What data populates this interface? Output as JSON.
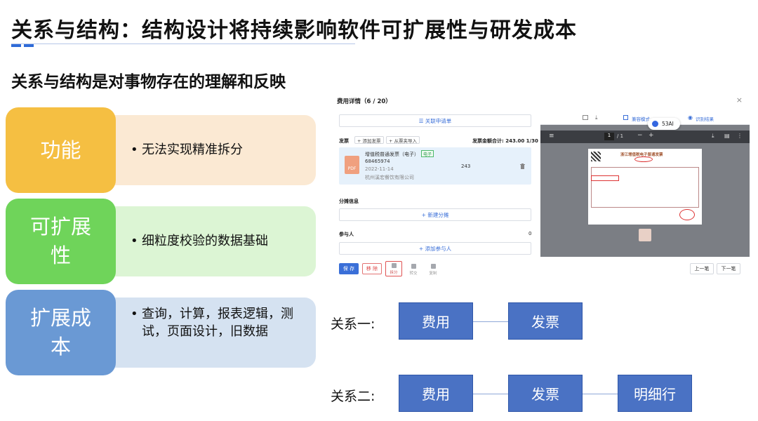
{
  "slide": {
    "title": "关系与结构：结构设计将持续影响软件可扩展性与研发成本",
    "subtitle": "关系与结构是对事物存在的理解和反映",
    "rows": [
      {
        "tag": "功能",
        "bullet": "无法实现精准拆分",
        "tag_color": "#f5bf42",
        "bg_color": "#fbe9d3"
      },
      {
        "tag": "可扩展性",
        "bullet": "细粒度校验的数据基础",
        "tag_color": "#6fd45a",
        "bg_color": "#dcf5d4"
      },
      {
        "tag": "扩展成本",
        "bullet": "查询，计算，报表逻辑，测试，页面设计，旧数据",
        "tag_color": "#6a99d4",
        "bg_color": "#d5e2f1"
      }
    ],
    "relation_one": {
      "label": "关系一:",
      "boxes": [
        "费用",
        "发票"
      ]
    },
    "relation_two": {
      "label": "关系二:",
      "boxes": [
        "费用",
        "发票",
        "明细行"
      ]
    },
    "box_color": "#4a72c4"
  },
  "screenshot": {
    "header": "费用详情（6 / 20）",
    "close": "×",
    "link_request": "☰ 关联申请单",
    "invoice_label": "发票",
    "add_invoice": "+ 添加发票",
    "import_folder": "+ 从票夹导入",
    "invoice_total": "发票金额合计: 243.00  1/30",
    "invoice_item": {
      "name": "增值税普通发票（电子）",
      "badge": "电子",
      "number": "68465974",
      "date": "2022-11-14",
      "company": "杭州溪宏餐饮有限公司",
      "amount": "243",
      "delete_icon": "trash-icon",
      "pdf": "PDF"
    },
    "split_info_label": "分摊信息",
    "new_split": "+ 新建分摊",
    "participants_label": "参与人",
    "participants_count": "0",
    "add_participant": "+ 添加参与人",
    "save": "保 存",
    "remove": "移 除",
    "split": "拆分",
    "transfer": "转交",
    "copy": "复制",
    "prev": "上一笔",
    "next": "下一笔",
    "viewer_toolbar": {
      "compat_mode": "兼容模式",
      "recognize": "识别结果",
      "page": "1",
      "page_total": "/ 1"
    },
    "badge_53": "53AI",
    "invoice_doc_title": "浙江增值税电子普通发票"
  }
}
